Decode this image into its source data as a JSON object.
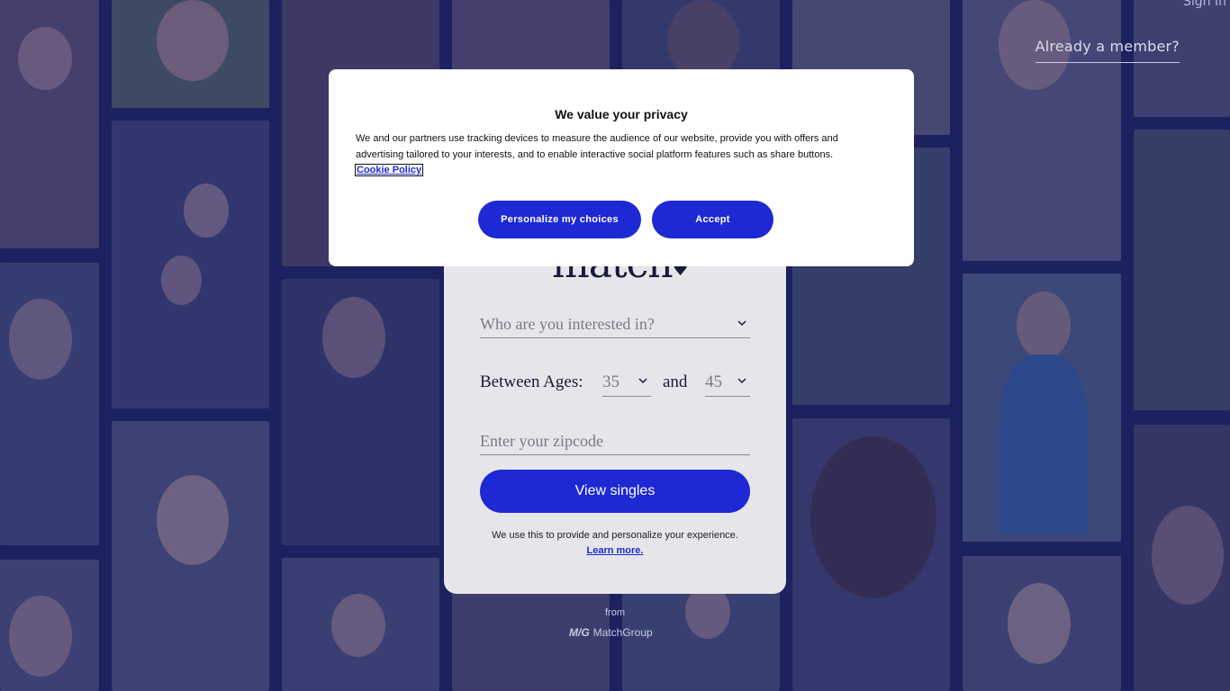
{
  "header": {
    "sign_in_label": "Sign In",
    "already_member_label": "Already a member?"
  },
  "card": {
    "logo_text": "match",
    "logo_heart": "♥",
    "interest_placeholder": "Who are you interested in?",
    "ages_label": "Between Ages:",
    "age_min": "35",
    "age_and": "and",
    "age_max": "45",
    "zipcode_placeholder": "Enter your zipcode",
    "view_button": "View singles",
    "note_text": "We use this to provide and personalize your experience.",
    "learn_more": "Learn more."
  },
  "footer": {
    "from_label": "from",
    "brand": "MatchGroup",
    "brand_mark": "M/G"
  },
  "privacy": {
    "title": "We value your privacy",
    "body": "We and our partners use tracking devices to measure the audience of our website, provide you with offers and advertising tailored to your interests, and to enable interactive social platform features such as share buttons.",
    "cookie_link": "Cookie Policy",
    "personalize_button": "Personalize my choices",
    "accept_button": "Accept"
  },
  "colors": {
    "accent": "#1d29d4",
    "overlay": "#2d3570",
    "card_bg": "#e6e6ea"
  }
}
